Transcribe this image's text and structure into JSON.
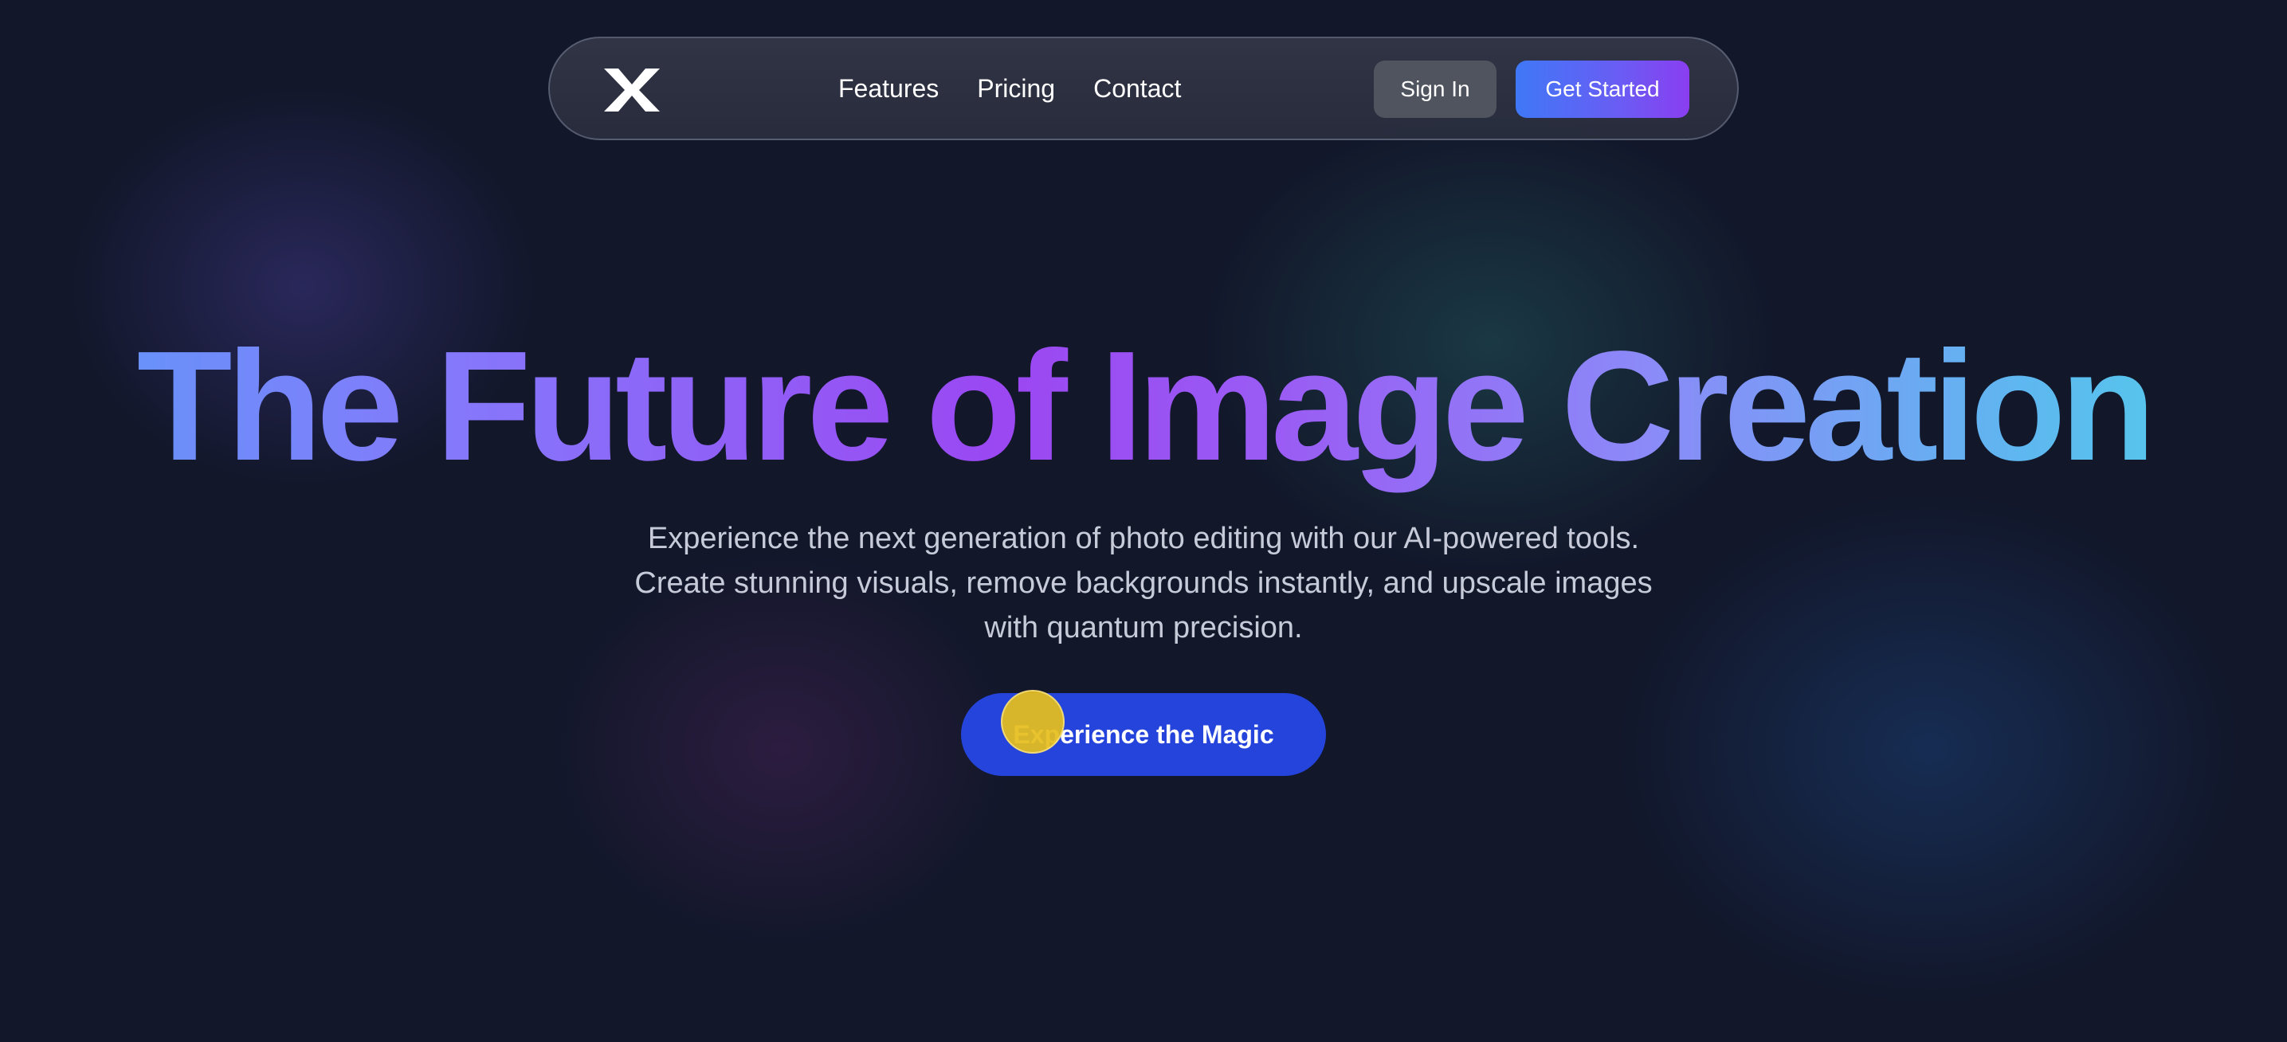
{
  "nav": {
    "logo_icon": "x-logo-icon",
    "links": [
      "Features",
      "Pricing",
      "Contact"
    ],
    "sign_in_label": "Sign In",
    "get_started_label": "Get Started"
  },
  "hero": {
    "title": "The Future of Image Creation",
    "subtitle": "Experience the next generation of photo editing with our AI-powered tools. Create stunning visuals, remove backgrounds instantly, and upscale images with quantum precision.",
    "cta_label": "Experience the Magic"
  },
  "colors": {
    "background": "#12172a",
    "cta": "#2444dc",
    "get_started_start": "#3f78f7",
    "get_started_end": "#8a3ef0",
    "title_gradient": [
      "#5d9cf8",
      "#9b47f2",
      "#4fd2e8"
    ],
    "cursor": "#e6be1e"
  }
}
